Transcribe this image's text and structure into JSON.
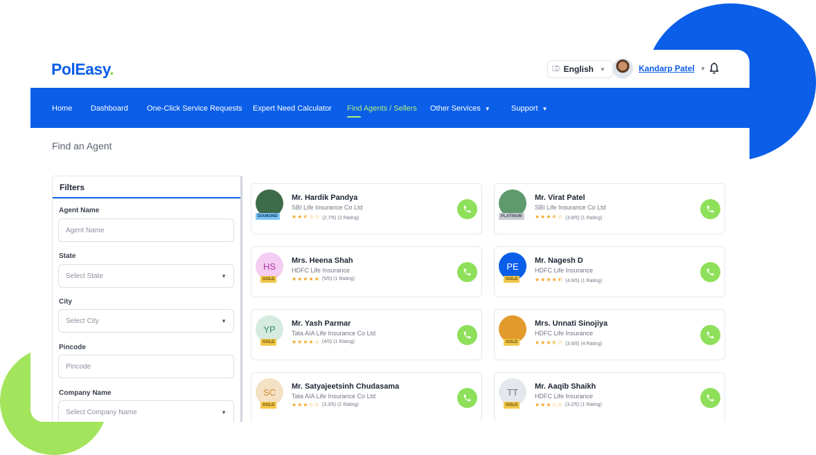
{
  "header": {
    "logo_text": "PolEasy",
    "logo_dot": ".",
    "language": {
      "icon": "translate-icon",
      "label": "English"
    },
    "user": {
      "name": "Kandarp Patel"
    }
  },
  "nav": {
    "items": [
      {
        "label": "Home"
      },
      {
        "label": "Dashboard"
      },
      {
        "label": "One-Click Service Requests"
      },
      {
        "label": "Expert Need Calculator"
      },
      {
        "label": "Find Agents / Sellers",
        "active": true
      },
      {
        "label": "Other Services",
        "dropdown": true
      },
      {
        "label": "Support",
        "dropdown": true
      }
    ]
  },
  "page": {
    "title": "Find an Agent"
  },
  "filters": {
    "title": "Filters",
    "fields": [
      {
        "label": "Agent Name",
        "placeholder": "Agent Name",
        "type": "text"
      },
      {
        "label": "State",
        "placeholder": "Select State",
        "type": "select"
      },
      {
        "label": "City",
        "placeholder": "Select City",
        "type": "select"
      },
      {
        "label": "Pincode",
        "placeholder": "Pincode",
        "type": "text"
      },
      {
        "label": "Company Name",
        "placeholder": "Select Company Name",
        "type": "select"
      }
    ]
  },
  "agents": [
    {
      "name": "Mr. Hardik Pandya",
      "company": "SBI Life Insurance Co Ltd",
      "stars": "★★⯪☆☆",
      "rating": "(2.7/5) (2 Rating)",
      "badge": "DIAMOND",
      "initials": "",
      "avatar_bg": "#3e6b4a",
      "avatar_fg": "#ffffff"
    },
    {
      "name": "Mr. Virat Patel",
      "company": "SBI Life Insurance Co Ltd",
      "stars": "★★★⯪☆",
      "rating": "(3.8/5) (1 Rating)",
      "badge": "PLATINUM",
      "initials": "",
      "avatar_bg": "#5f9a6c",
      "avatar_fg": "#ffffff"
    },
    {
      "name": "Mrs. Heena Shah",
      "company": "HDFC Life Insurance",
      "stars": "★★★★★",
      "rating": "(5/5) (1 Rating)",
      "badge": "GOLD",
      "initials": "HS",
      "avatar_bg": "#f4cdf3",
      "avatar_fg": "#b03aa8"
    },
    {
      "name": "Mr. Nagesh D",
      "company": "HDFC Life Insurance",
      "stars": "★★★★⯪",
      "rating": "(4.9/5) (1 Rating)",
      "badge": "GOLD",
      "initials": "PE",
      "avatar_bg": "#0a5ee8",
      "avatar_fg": "#ffffff"
    },
    {
      "name": "Mr. Yash Parmar",
      "company": "Tata AIA Life Insurance Co Ltd",
      "stars": "★★★★☆",
      "rating": "(4/5) (1 Rating)",
      "badge": "GOLD",
      "initials": "YP",
      "avatar_bg": "#d5ebe0",
      "avatar_fg": "#3a8b62"
    },
    {
      "name": "Mrs. Unnati Sinojiya",
      "company": "HDFC Life Insurance",
      "stars": "★★★⯪☆",
      "rating": "(3.6/5) (4 Rating)",
      "badge": "GOLD",
      "initials": "",
      "avatar_bg": "#e39a2c",
      "avatar_fg": "#ffffff"
    },
    {
      "name": "Mr. Satyajeetsinh Chudasama",
      "company": "Tata AIA Life Insurance Co Ltd",
      "stars": "★★★☆☆",
      "rating": "(3.3/5) (2 Rating)",
      "badge": "GOLD",
      "initials": "SC",
      "avatar_bg": "#f5e1c4",
      "avatar_fg": "#d08a32"
    },
    {
      "name": "Mr. Aaqib Shaikh",
      "company": "HDFC Life Insurance",
      "stars": "★★★☆☆",
      "rating": "(3.2/5) (1 Rating)",
      "badge": "GOLD",
      "initials": "TT",
      "avatar_bg": "#e4e7eb",
      "avatar_fg": "#6f7683"
    }
  ],
  "colors": {
    "brand": "#0a5ee8",
    "accent": "#8ee05a",
    "star": "#f2a323"
  }
}
